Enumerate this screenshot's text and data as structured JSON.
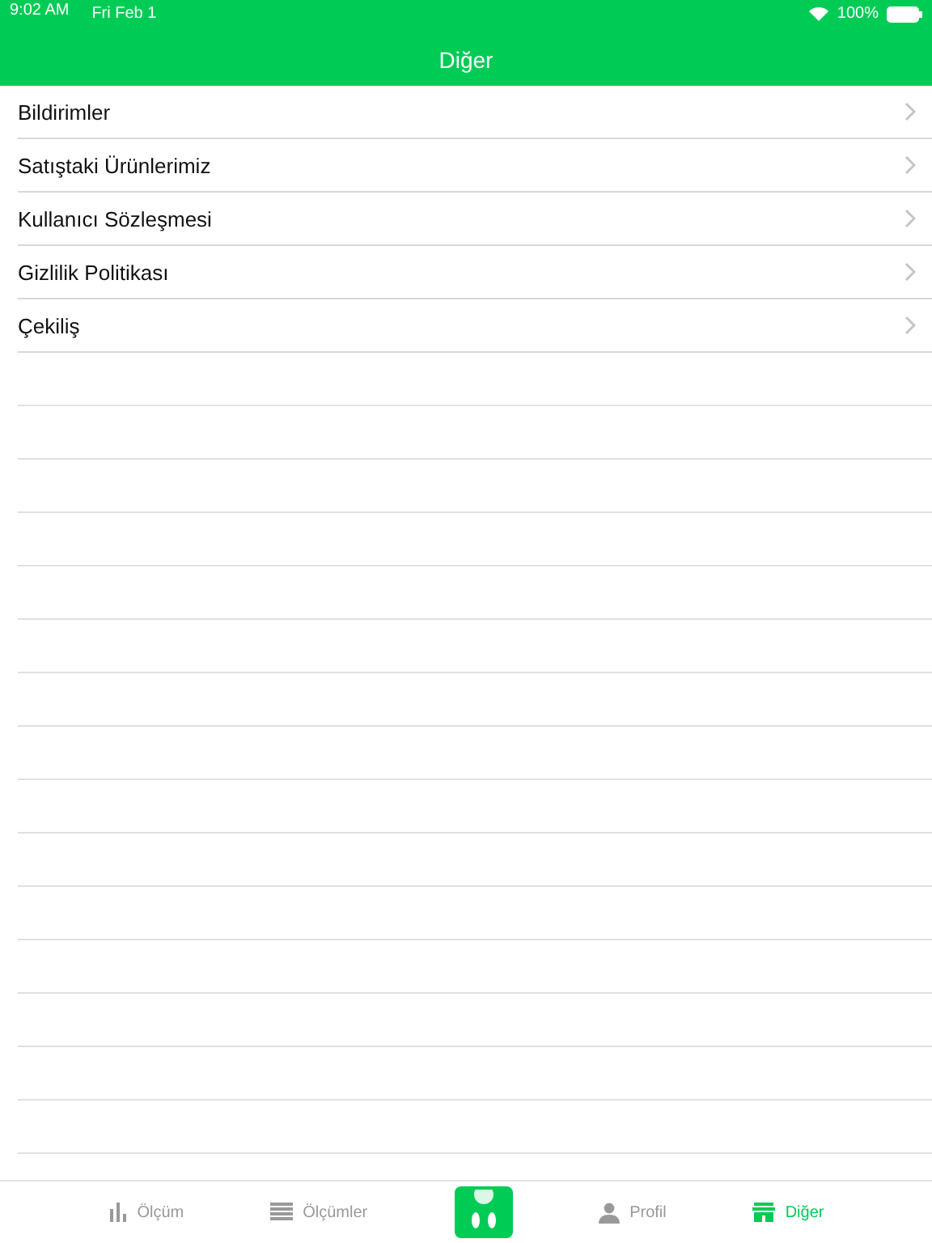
{
  "status_bar": {
    "time": "9:02 AM",
    "date": "Fri Feb 1",
    "battery": "100%"
  },
  "nav": {
    "title": "Diğer"
  },
  "menu": [
    {
      "label": "Bildirimler"
    },
    {
      "label": "Satıştaki Ürünlerimiz"
    },
    {
      "label": "Kullanıcı Sözleşmesi"
    },
    {
      "label": "Gizlilik Politikası"
    },
    {
      "label": "Çekiliş"
    }
  ],
  "tabs": [
    {
      "kind": "chart",
      "label": "Ölçüm",
      "selected": false
    },
    {
      "kind": "list",
      "label": "Ölçümler",
      "selected": false
    },
    {
      "kind": "logo",
      "selected": false
    },
    {
      "kind": "person",
      "label": "Profil",
      "selected": false
    },
    {
      "kind": "store",
      "label": "Diğer",
      "selected": true
    }
  ]
}
